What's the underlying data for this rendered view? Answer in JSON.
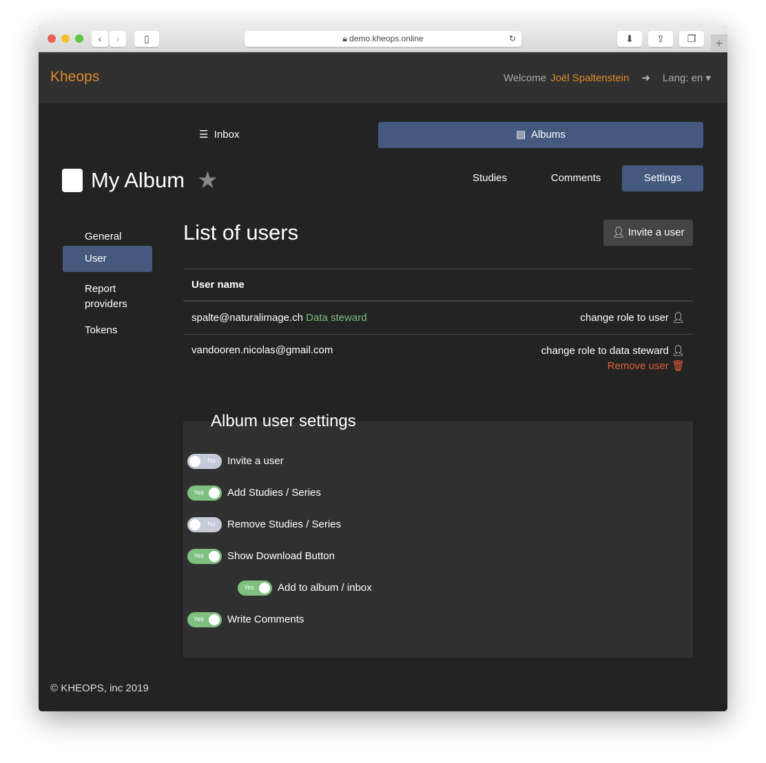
{
  "browser": {
    "url": "demo.kheops.online"
  },
  "header": {
    "brand": "Kheops",
    "welcome": "Welcome",
    "user": "Joël Spaltenstein",
    "lang": "Lang: en"
  },
  "nav": {
    "inbox": "Inbox",
    "albums": "Albums"
  },
  "album": {
    "title": "My Album",
    "tabs": [
      "Studies",
      "Comments",
      "Settings"
    ],
    "active_tab": "Settings"
  },
  "sidebar": {
    "items": [
      "General",
      "User",
      "Report providers",
      "Tokens"
    ],
    "active": "User"
  },
  "users": {
    "title": "List of users",
    "invite_button": "Invite a user",
    "column": "User name",
    "rows": [
      {
        "email": "spalte@naturalimage.ch",
        "role": "Data steward",
        "action": "change role to user"
      },
      {
        "email": "vandooren.nicolas@gmail.com",
        "role": "",
        "action": "change role to data steward",
        "remove": "Remove user"
      }
    ]
  },
  "settings": {
    "title": "Album user settings",
    "items": [
      {
        "label": "Invite a user",
        "state": "No",
        "on": false
      },
      {
        "label": "Add Studies / Series",
        "state": "Yes",
        "on": true
      },
      {
        "label": "Remove Studies / Series",
        "state": "No",
        "on": false
      },
      {
        "label": "Show Download Button",
        "state": "Yes",
        "on": true
      },
      {
        "label": "Add to album / inbox",
        "state": "Yes",
        "on": true
      },
      {
        "label": "Write Comments",
        "state": "Yes",
        "on": true
      }
    ]
  },
  "footer": "© KHEOPS, inc 2019",
  "colors": {
    "accent": "#e08a2c",
    "primary": "#45597e",
    "green": "#7fbf7f",
    "danger": "#e0603a"
  }
}
